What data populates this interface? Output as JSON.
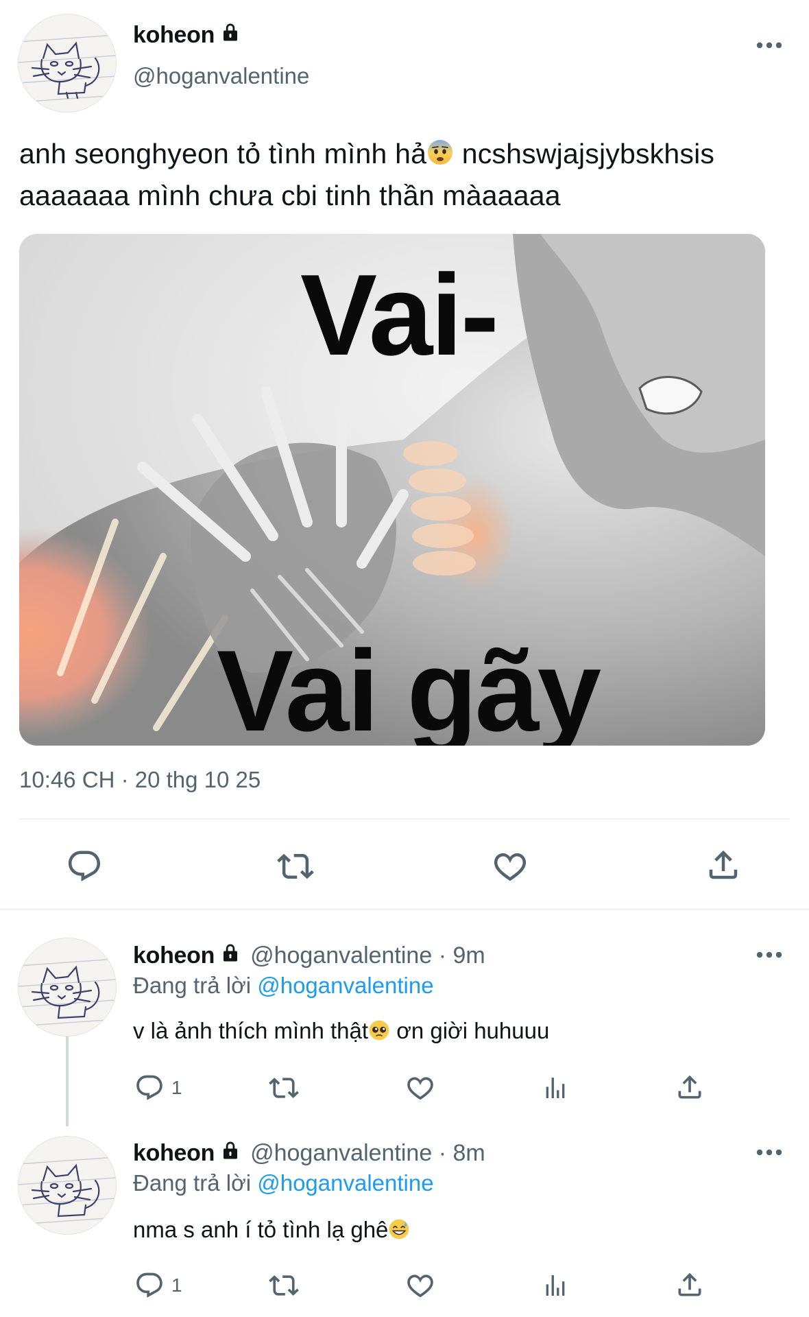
{
  "tweet": {
    "display_name": "koheon",
    "handle": "@hoganvalentine",
    "text_line1": "anh seonghyeon tỏ tình mình hả",
    "text_line1_after": " ncshswjajsjybskhsis",
    "text_line2": "aaaaaaa mình chưa cbi tinh thần màaaaaa",
    "emoji_1": "fearful-face",
    "media": {
      "caption_top": "Vai-",
      "caption_bottom": "Vai gãy"
    },
    "timestamp": "10:46 CH · 20 thg 10 25",
    "actions": [
      "reply-icon",
      "retweet-icon",
      "like-icon",
      "share-icon"
    ]
  },
  "replies": [
    {
      "display_name": "koheon",
      "meta": "@hoganvalentine · 9m",
      "replying_prefix": "Đang trả lời ",
      "replying_to": "@hoganvalentine",
      "text_before": "v là ảnh thích mình thật",
      "emoji": "pleading-face",
      "text_after": " ơn giời huhuuu",
      "reply_count": "1"
    },
    {
      "display_name": "koheon",
      "meta": "@hoganvalentine · 8m",
      "replying_prefix": "Đang trả lời ",
      "replying_to": "@hoganvalentine",
      "text_before": "nma s anh í tỏ tình lạ ghê",
      "emoji": "grinning-sweat-face",
      "text_after": "",
      "reply_count": "1"
    }
  ],
  "colors": {
    "text": "#0f1419",
    "secondary": "#536471",
    "link": "#1d9bf0",
    "divider": "#eff3f4"
  }
}
